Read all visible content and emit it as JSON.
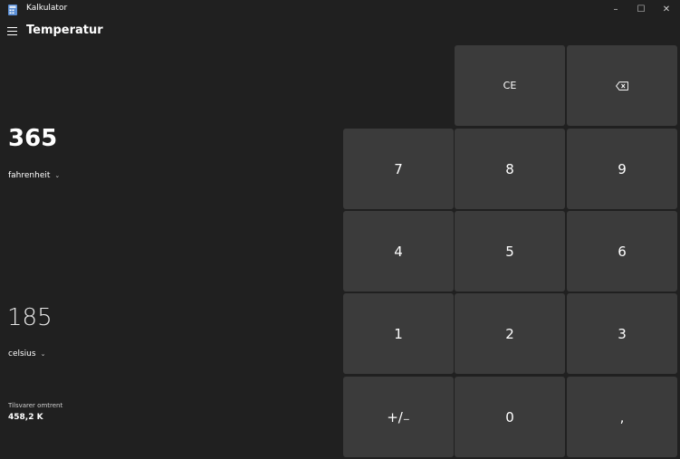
{
  "window": {
    "title": "Kalkulator",
    "minimize_glyph": "–",
    "maximize_glyph": "☐",
    "close_glyph": "✕"
  },
  "header": {
    "mode_title": "Temperatur"
  },
  "converter": {
    "from_value": "365",
    "from_unit": "fahrenheit",
    "to_value": "185",
    "to_unit": "celsius",
    "equivalent_label": "Tilsvarer omtrent",
    "equivalent_value": "458,2 K"
  },
  "keypad": {
    "clear_entry": "CE",
    "backspace_icon": "backspace-icon",
    "digits": {
      "d7": "7",
      "d8": "8",
      "d9": "9",
      "d4": "4",
      "d5": "5",
      "d6": "6",
      "d1": "1",
      "d2": "2",
      "d3": "3",
      "d0": "0"
    },
    "negate": "+/₋",
    "decimal": ","
  },
  "colors": {
    "background": "#202020",
    "key": "#3b3b3b"
  }
}
